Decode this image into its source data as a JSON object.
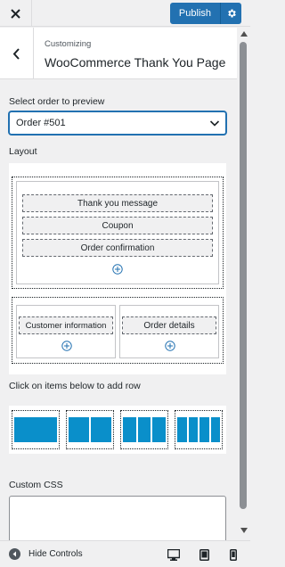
{
  "topbar": {
    "close_label": "Close",
    "publish_label": "Publish"
  },
  "header": {
    "sub": "Customizing",
    "title": "WooCommerce Thank You Page"
  },
  "preview": {
    "label": "Select order to preview",
    "selected": "Order #501"
  },
  "layout": {
    "label": "Layout",
    "rows": [
      {
        "columns": [
          {
            "items": [
              "Thank you message",
              "Coupon",
              "Order confirmation"
            ]
          }
        ]
      },
      {
        "columns": [
          {
            "items": [
              "Customer information"
            ]
          },
          {
            "items": [
              "Order details"
            ]
          }
        ]
      }
    ]
  },
  "add_row": {
    "label": "Click on items below to add row",
    "options": [
      1,
      2,
      3,
      4
    ]
  },
  "custom_css": {
    "label": "Custom CSS",
    "value": ""
  },
  "footer": {
    "hide_controls": "Hide Controls"
  },
  "colors": {
    "accent": "#2271b1",
    "layout_block": "#0a8fca"
  }
}
